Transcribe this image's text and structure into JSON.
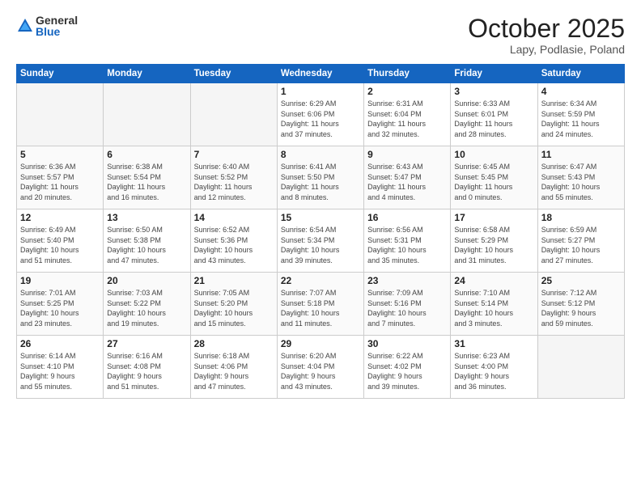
{
  "logo": {
    "general": "General",
    "blue": "Blue"
  },
  "title": "October 2025",
  "location": "Lapy, Podlasie, Poland",
  "headers": [
    "Sunday",
    "Monday",
    "Tuesday",
    "Wednesday",
    "Thursday",
    "Friday",
    "Saturday"
  ],
  "weeks": [
    [
      {
        "day": "",
        "info": ""
      },
      {
        "day": "",
        "info": ""
      },
      {
        "day": "",
        "info": ""
      },
      {
        "day": "1",
        "info": "Sunrise: 6:29 AM\nSunset: 6:06 PM\nDaylight: 11 hours\nand 37 minutes."
      },
      {
        "day": "2",
        "info": "Sunrise: 6:31 AM\nSunset: 6:04 PM\nDaylight: 11 hours\nand 32 minutes."
      },
      {
        "day": "3",
        "info": "Sunrise: 6:33 AM\nSunset: 6:01 PM\nDaylight: 11 hours\nand 28 minutes."
      },
      {
        "day": "4",
        "info": "Sunrise: 6:34 AM\nSunset: 5:59 PM\nDaylight: 11 hours\nand 24 minutes."
      }
    ],
    [
      {
        "day": "5",
        "info": "Sunrise: 6:36 AM\nSunset: 5:57 PM\nDaylight: 11 hours\nand 20 minutes."
      },
      {
        "day": "6",
        "info": "Sunrise: 6:38 AM\nSunset: 5:54 PM\nDaylight: 11 hours\nand 16 minutes."
      },
      {
        "day": "7",
        "info": "Sunrise: 6:40 AM\nSunset: 5:52 PM\nDaylight: 11 hours\nand 12 minutes."
      },
      {
        "day": "8",
        "info": "Sunrise: 6:41 AM\nSunset: 5:50 PM\nDaylight: 11 hours\nand 8 minutes."
      },
      {
        "day": "9",
        "info": "Sunrise: 6:43 AM\nSunset: 5:47 PM\nDaylight: 11 hours\nand 4 minutes."
      },
      {
        "day": "10",
        "info": "Sunrise: 6:45 AM\nSunset: 5:45 PM\nDaylight: 11 hours\nand 0 minutes."
      },
      {
        "day": "11",
        "info": "Sunrise: 6:47 AM\nSunset: 5:43 PM\nDaylight: 10 hours\nand 55 minutes."
      }
    ],
    [
      {
        "day": "12",
        "info": "Sunrise: 6:49 AM\nSunset: 5:40 PM\nDaylight: 10 hours\nand 51 minutes."
      },
      {
        "day": "13",
        "info": "Sunrise: 6:50 AM\nSunset: 5:38 PM\nDaylight: 10 hours\nand 47 minutes."
      },
      {
        "day": "14",
        "info": "Sunrise: 6:52 AM\nSunset: 5:36 PM\nDaylight: 10 hours\nand 43 minutes."
      },
      {
        "day": "15",
        "info": "Sunrise: 6:54 AM\nSunset: 5:34 PM\nDaylight: 10 hours\nand 39 minutes."
      },
      {
        "day": "16",
        "info": "Sunrise: 6:56 AM\nSunset: 5:31 PM\nDaylight: 10 hours\nand 35 minutes."
      },
      {
        "day": "17",
        "info": "Sunrise: 6:58 AM\nSunset: 5:29 PM\nDaylight: 10 hours\nand 31 minutes."
      },
      {
        "day": "18",
        "info": "Sunrise: 6:59 AM\nSunset: 5:27 PM\nDaylight: 10 hours\nand 27 minutes."
      }
    ],
    [
      {
        "day": "19",
        "info": "Sunrise: 7:01 AM\nSunset: 5:25 PM\nDaylight: 10 hours\nand 23 minutes."
      },
      {
        "day": "20",
        "info": "Sunrise: 7:03 AM\nSunset: 5:22 PM\nDaylight: 10 hours\nand 19 minutes."
      },
      {
        "day": "21",
        "info": "Sunrise: 7:05 AM\nSunset: 5:20 PM\nDaylight: 10 hours\nand 15 minutes."
      },
      {
        "day": "22",
        "info": "Sunrise: 7:07 AM\nSunset: 5:18 PM\nDaylight: 10 hours\nand 11 minutes."
      },
      {
        "day": "23",
        "info": "Sunrise: 7:09 AM\nSunset: 5:16 PM\nDaylight: 10 hours\nand 7 minutes."
      },
      {
        "day": "24",
        "info": "Sunrise: 7:10 AM\nSunset: 5:14 PM\nDaylight: 10 hours\nand 3 minutes."
      },
      {
        "day": "25",
        "info": "Sunrise: 7:12 AM\nSunset: 5:12 PM\nDaylight: 9 hours\nand 59 minutes."
      }
    ],
    [
      {
        "day": "26",
        "info": "Sunrise: 6:14 AM\nSunset: 4:10 PM\nDaylight: 9 hours\nand 55 minutes."
      },
      {
        "day": "27",
        "info": "Sunrise: 6:16 AM\nSunset: 4:08 PM\nDaylight: 9 hours\nand 51 minutes."
      },
      {
        "day": "28",
        "info": "Sunrise: 6:18 AM\nSunset: 4:06 PM\nDaylight: 9 hours\nand 47 minutes."
      },
      {
        "day": "29",
        "info": "Sunrise: 6:20 AM\nSunset: 4:04 PM\nDaylight: 9 hours\nand 43 minutes."
      },
      {
        "day": "30",
        "info": "Sunrise: 6:22 AM\nSunset: 4:02 PM\nDaylight: 9 hours\nand 39 minutes."
      },
      {
        "day": "31",
        "info": "Sunrise: 6:23 AM\nSunset: 4:00 PM\nDaylight: 9 hours\nand 36 minutes."
      },
      {
        "day": "",
        "info": ""
      }
    ]
  ]
}
